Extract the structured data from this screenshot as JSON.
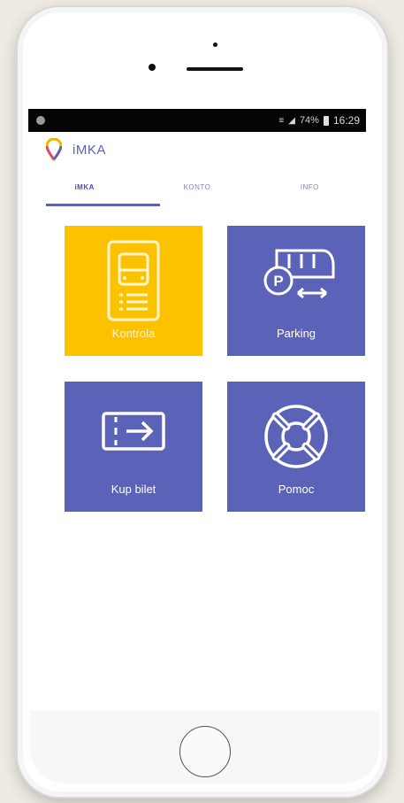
{
  "status_bar": {
    "signal": "74%",
    "time": "16:29"
  },
  "app_bar": {
    "title": "iMKA"
  },
  "tabs": [
    {
      "label": "iMKA",
      "active": true
    },
    {
      "label": "KONTO",
      "active": false
    },
    {
      "label": "INFO",
      "active": false
    }
  ],
  "tiles": [
    {
      "label": "Kontrola",
      "icon": "bus-ticket-icon",
      "color": "#fcc200"
    },
    {
      "label": "Parking",
      "icon": "parking-tram-icon",
      "color": "#5b63b8"
    },
    {
      "label": "Kup bilet",
      "icon": "ticket-arrow-icon",
      "color": "#5b63b8"
    },
    {
      "label": "Pomoc",
      "icon": "lifebuoy-icon",
      "color": "#5b63b8"
    }
  ],
  "colors": {
    "accent": "#5c62b3",
    "tile_yellow": "#fcc200",
    "tile_blue": "#5b63b8"
  }
}
